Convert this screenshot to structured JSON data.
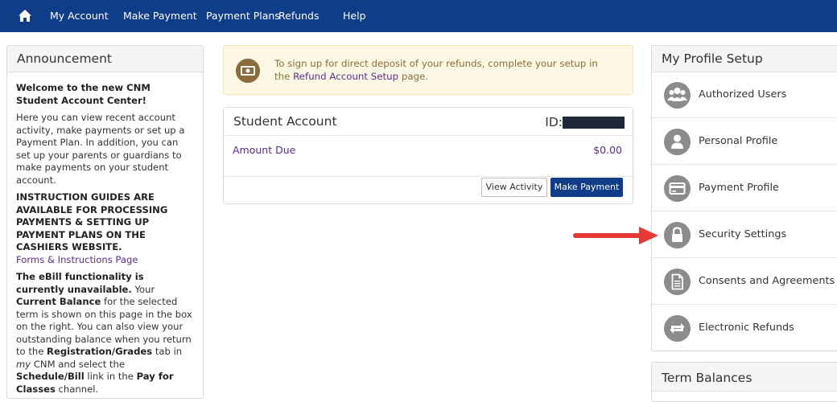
{
  "nav": {
    "items": [
      "My Account",
      "Make Payment",
      "Payment Plans",
      "Refunds",
      "Help"
    ]
  },
  "announcement": {
    "title": "Announcement",
    "welcome": "Welcome to the new CNM Student Account Center!",
    "intro": "Here you can view recent account activity, make payments or set up a Payment Plan. In addition, you can set up your parents or guardians to make payments on your student account.",
    "guides": "INSTRUCTION GUIDES ARE AVAILABLE FOR PROCESSING PAYMENTS & SETTING UP PAYMENT PLANS ON THE CASHIERS WEBSITE.",
    "forms_link": "Forms & Instructions Page",
    "ebill_bold": "The eBill functionality is currently unavailable.",
    "ebill_1": " Your ",
    "current_balance": "Current Balance",
    "ebill_2": " for the selected term is shown on this page in the box on the right. You can also view your outstanding balance when you return to the ",
    "reg_grades": "Registration/Grades",
    "ebill_3": " tab in ",
    "my": "my",
    "ebill_4": " CNM and select the ",
    "schedule_bill": "Schedule/Bill",
    "ebill_5": " link in the ",
    "pay_for_classes": "Pay for Classes",
    "ebill_6": " channel."
  },
  "alert": {
    "text_before": "To sign up for direct deposit of your refunds, complete your setup in the ",
    "link": "Refund Account Setup",
    "text_after": " page."
  },
  "account": {
    "title": "Student Account",
    "id_label": "ID:",
    "amount_due_label": "Amount Due",
    "amount_due_value": "$0.00",
    "view_activity": "View Activity",
    "make_payment": "Make Payment"
  },
  "profile": {
    "title": "My Profile Setup",
    "items": [
      {
        "label": "Authorized Users",
        "icon": "users-icon"
      },
      {
        "label": "Personal Profile",
        "icon": "user-icon"
      },
      {
        "label": "Payment Profile",
        "icon": "credit-card-icon"
      },
      {
        "label": "Security Settings",
        "icon": "lock-icon"
      },
      {
        "label": "Consents and Agreements",
        "icon": "document-icon"
      },
      {
        "label": "Electronic Refunds",
        "icon": "refund-icon"
      }
    ]
  },
  "terms": {
    "title": "Term Balances"
  },
  "colors": {
    "nav_bg": "#0f3d87",
    "link": "#5b2d8e",
    "alert_bg": "#fcf8e3",
    "alert_text": "#8a6d3b",
    "icon_gray": "#8c8c8c",
    "arrow_red": "#e53935"
  }
}
